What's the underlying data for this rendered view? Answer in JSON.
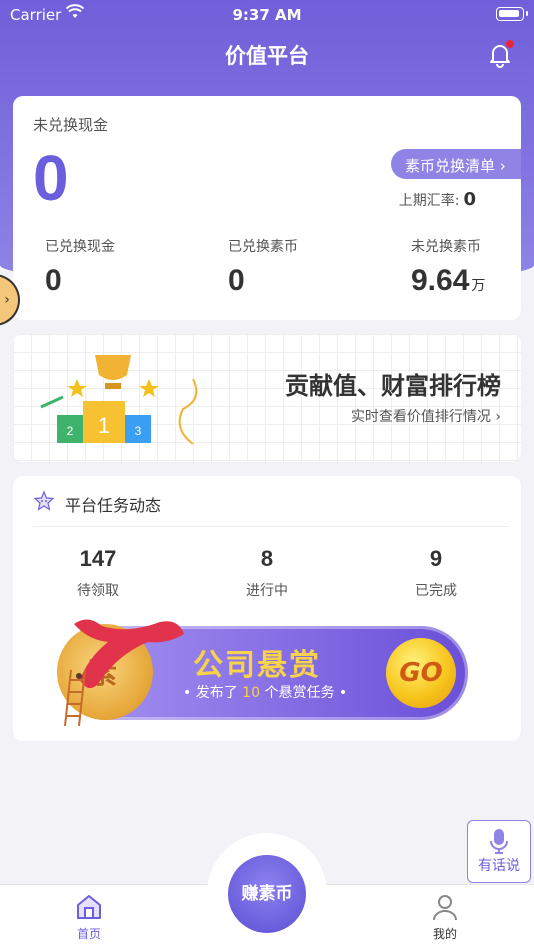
{
  "status_bar": {
    "carrier": "Carrier",
    "time": "9:37 AM"
  },
  "nav": {
    "title": "价值平台"
  },
  "cash_card": {
    "unexchanged_label": "未兑换现金",
    "unexchanged_value": "0",
    "list_button": "素币兑换清单 ›",
    "rate_label": "上期汇率:",
    "rate_value": "0",
    "stats": [
      {
        "label": "已兑换现金",
        "value": "0",
        "unit": ""
      },
      {
        "label": "已兑换素币",
        "value": "0",
        "unit": ""
      },
      {
        "label": "未兑换素币",
        "value": "9.64",
        "unit": "万"
      }
    ]
  },
  "side_tab": {
    "glyph": "›"
  },
  "ranking": {
    "title": "贡献值、财富排行榜",
    "subtitle": "实时查看价值排行情况 ›",
    "podium": [
      "2",
      "1",
      "3"
    ]
  },
  "tasks": {
    "title": "平台任务动态",
    "stats": [
      {
        "value": "147",
        "label": "待领取"
      },
      {
        "value": "8",
        "label": "进行中"
      },
      {
        "value": "9",
        "label": "已完成"
      }
    ],
    "banner": {
      "coin_char": "素",
      "title": "公司悬赏",
      "sub_prefix": "• 发布了",
      "sub_count": "10",
      "sub_suffix": "个悬赏任务 •",
      "go": "GO"
    }
  },
  "voice": {
    "label": "有话说"
  },
  "tabbar": {
    "home": "首页",
    "center": "赚素币",
    "me": "我的"
  },
  "colors": {
    "brand": "#6b5fde",
    "accent_light": "#8f84e6",
    "notification_dot": "#e8283a",
    "gold": "#f7d24a"
  }
}
